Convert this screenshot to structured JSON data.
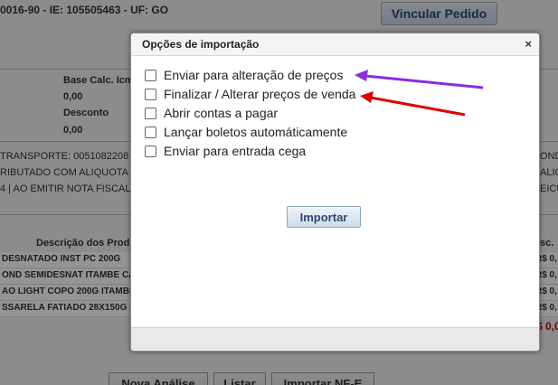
{
  "page": {
    "header_text": "0016-90 - IE: 105505463 - UF: GO",
    "vincular_button": "Vincular Pedido",
    "labels": {
      "base_calc": "Base Calc. Icms",
      "desconto": "Desconto",
      "val1": "0,00",
      "val2": "0,00"
    },
    "info_lines": [
      "TRANSPORTE: 0051082208 FA",
      "RIBUTADO COM ALIQUOTA ZE",
      "4 | AO EMITIR NOTA FISCAL PA"
    ],
    "info_right": [
      "OND",
      "ALIQ",
      "EICU"
    ],
    "table_header": "Descrição dos Prod",
    "table_header_right": "sc.",
    "table_rows": [
      "DESNATADO INST PC 200G",
      "OND SEMIDESNAT ITAMBE CA",
      "AO LIGHT COPO 200G ITAMBE",
      "SSARELA FATIADO 28X150G IT"
    ],
    "table_rows_right": [
      "R$ 0,",
      "R$ 0,",
      "R$ 0,",
      "R$ 0,"
    ],
    "total_right": "$ 0,0",
    "bottom_buttons": [
      "Nova Análise",
      "Listar",
      "Importar NF-E"
    ]
  },
  "dialog": {
    "title": "Opções de importação",
    "close": "×",
    "options": [
      "Enviar para alteração de preços",
      "Finalizar / Alterar preços de venda",
      "Abrir contas a pagar",
      "Lançar boletos automáticamente",
      "Enviar para entrada cega"
    ],
    "import_button": "Importar"
  },
  "colors": {
    "arrow_purple": "#8a2be2",
    "arrow_red": "#e00000"
  }
}
